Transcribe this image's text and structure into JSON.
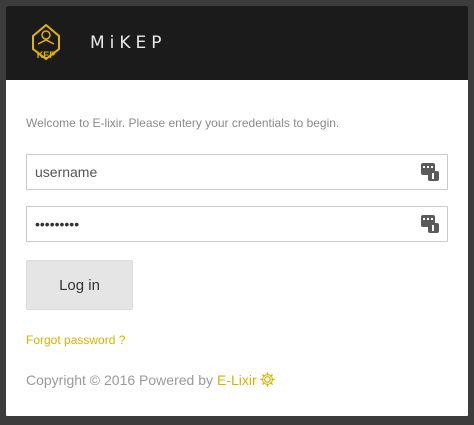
{
  "app": {
    "title": "MiKEP",
    "logo_text": "KEP"
  },
  "login": {
    "welcome": "Welcome to E-lixir. Please entery your credentials to begin.",
    "username_placeholder": "username",
    "password_value": "•••••••••",
    "login_label": "Log in",
    "forgot_label": "Forgot password ?"
  },
  "footer": {
    "copyright": "Copyright © 2016 Powered by",
    "brand": "E-Lixir"
  },
  "colors": {
    "header_bg": "#1b1b1b",
    "accent": "#d6b300",
    "button_bg": "#e5e5e5"
  },
  "icons": [
    "kep-logo-icon",
    "keyboard-icon",
    "gear-icon"
  ]
}
